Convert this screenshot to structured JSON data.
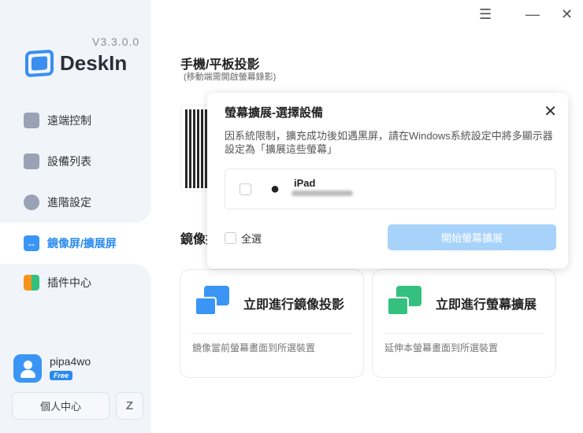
{
  "app": {
    "version": "V3.3.0.0",
    "name": "DeskIn"
  },
  "window": {
    "menu_icon": "☰",
    "minimize_icon": "—",
    "close_icon": "✕"
  },
  "nav": [
    {
      "label": "遠端控制",
      "icon": "remote-control-icon"
    },
    {
      "label": "設備列表",
      "icon": "device-list-icon"
    },
    {
      "label": "進階設定",
      "icon": "gear-icon"
    },
    {
      "label": "鏡像屏/擴展屏",
      "icon": "mirror-extend-icon",
      "active": true
    },
    {
      "label": "插件中心",
      "icon": "plugin-icon"
    }
  ],
  "user": {
    "name": "pipa4wo",
    "plan": "Free",
    "profile_button": "個人中心",
    "switch_icon": "Z"
  },
  "main": {
    "phone_title": "手機/平板投影",
    "phone_sub": "(移動端需開啟螢幕錄影)",
    "section_title": "鏡像投",
    "cards": [
      {
        "title": "立即進行鏡像投影",
        "desc": "鏡像當前螢幕畫面到所選裝置"
      },
      {
        "title": "立即進行螢幕擴展",
        "desc": "延伸本螢幕畫面到所選裝置"
      }
    ]
  },
  "modal": {
    "title": "螢幕擴展-選擇設備",
    "close": "✕",
    "desc": "因系統限制，擴充成功後如遇黑屏，請在Windows系統設定中將多顯示器設定為「擴展這些螢幕」",
    "devices": [
      {
        "name": "iPad",
        "icon": ""
      }
    ],
    "select_all": "全選",
    "start_button": "開始螢幕擴展"
  },
  "colors": {
    "accent": "#2a8af0",
    "green": "#34c17f",
    "disabled_button": "#a7d3fb"
  }
}
